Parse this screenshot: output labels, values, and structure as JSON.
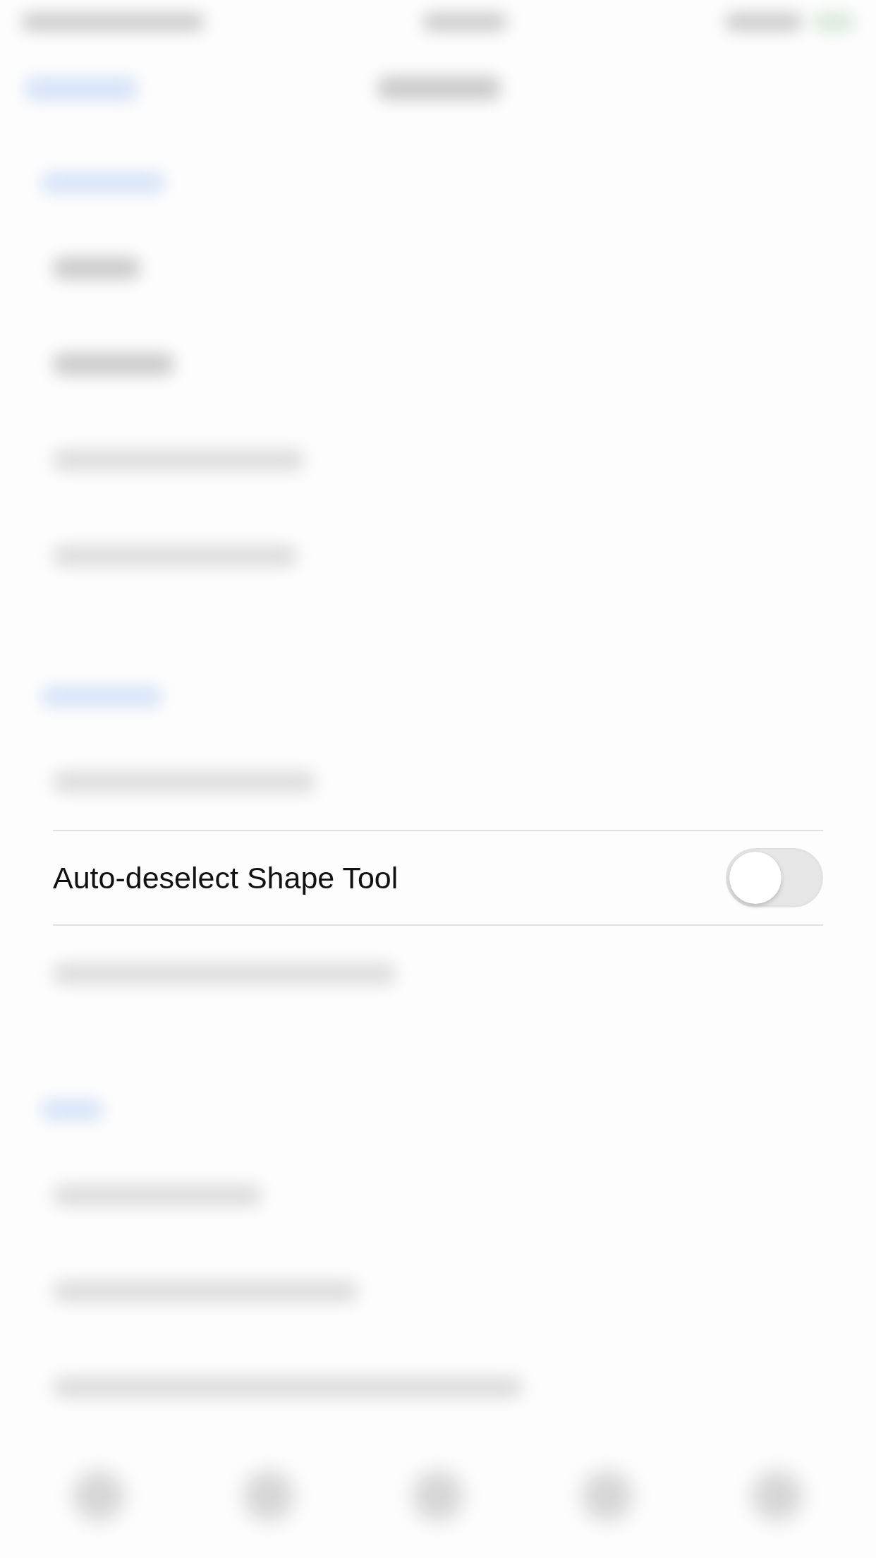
{
  "sections": [
    {
      "rows": [
        {
          "kind": "blurred"
        },
        {
          "kind": "blurred"
        },
        {
          "kind": "blurred"
        },
        {
          "kind": "blurred"
        }
      ]
    },
    {
      "rows": [
        {
          "kind": "blurred"
        },
        {
          "kind": "toggle",
          "label": "Auto-deselect Shape Tool",
          "on": false
        },
        {
          "kind": "blurred"
        }
      ]
    },
    {
      "rows": [
        {
          "kind": "blurred"
        },
        {
          "kind": "blurred"
        },
        {
          "kind": "blurred"
        }
      ]
    }
  ]
}
